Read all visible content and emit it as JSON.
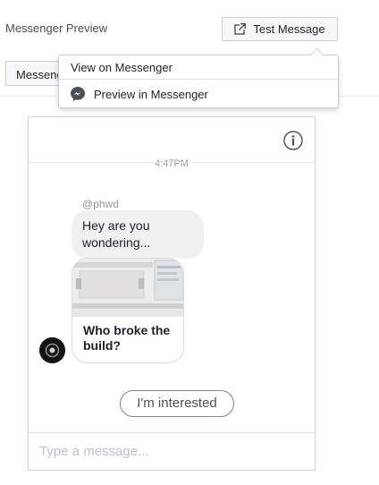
{
  "header": {
    "title": "Messenger Preview",
    "test_button_label": "Test Message",
    "background_tab_label": "Messenger Preview"
  },
  "dropdown": {
    "items": [
      {
        "label": "View on Messenger"
      },
      {
        "label": "Preview in Messenger",
        "icon": "messenger-icon"
      }
    ]
  },
  "preview": {
    "timestamp": "4:47PM",
    "sender": "@phwd",
    "message": "Hey are you wondering...",
    "card_title": "Who broke the build?",
    "quick_reply": "I'm interested",
    "composer_placeholder": "Type a message..."
  },
  "colors": {
    "messenger_blue": "#0084ff",
    "bubble_gray": "#f1f0f0",
    "border": "#ccd0d5"
  }
}
